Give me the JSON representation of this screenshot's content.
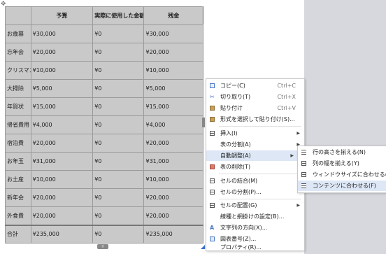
{
  "table": {
    "headers": [
      "",
      "予算",
      "実際に使用した金額",
      "残金"
    ],
    "rows": [
      [
        "お歳暮",
        "¥30,000",
        "¥0",
        "¥30,000"
      ],
      [
        "忘年会",
        "¥20,000",
        "¥0",
        "¥20,000"
      ],
      [
        "クリスマス",
        "¥10,000",
        "¥0",
        "¥10,000"
      ],
      [
        "大掃除",
        "¥5,000",
        "¥0",
        "¥5,000"
      ],
      [
        "年賀状",
        "¥15,000",
        "¥0",
        "¥15,000"
      ],
      [
        "帰省費用",
        "¥4,000",
        "¥0",
        "¥4,000"
      ],
      [
        "宿泊費",
        "¥20,000",
        "¥0",
        "¥20,000"
      ],
      [
        "お年玉",
        "¥31,000",
        "¥0",
        "¥31,000"
      ],
      [
        "お土産",
        "¥10,000",
        "¥0",
        "¥10,000"
      ],
      [
        "新年会",
        "¥20,000",
        "¥0",
        "¥20,000"
      ],
      [
        "外食費",
        "¥20,000",
        "¥0",
        "¥20,000"
      ]
    ],
    "total": [
      "合計",
      "¥235,000",
      "¥0",
      "¥235,000"
    ]
  },
  "menu": {
    "copy": {
      "label": "コピー(C)",
      "shortcut": "Ctrl+C"
    },
    "cut": {
      "label": "切り取り(T)",
      "shortcut": "Ctrl+X"
    },
    "paste": {
      "label": "貼り付け",
      "shortcut": "Ctrl+V"
    },
    "paste_special": {
      "label": "形式を選択して貼り付け(S)..."
    },
    "insert": {
      "label": "挿入(I)"
    },
    "split_table": {
      "label": "表の分割(A)"
    },
    "autofit": {
      "label": "自動調整(A)"
    },
    "delete_table": {
      "label": "表の削除(T)"
    },
    "merge_cells": {
      "label": "セルの結合(M)"
    },
    "split_cells": {
      "label": "セルの分割(P)..."
    },
    "cell_alignment": {
      "label": "セルの配置(G)"
    },
    "borders": {
      "label": "線種と網掛けの設定(B)..."
    },
    "text_direction": {
      "label": "文字列の方向(X)..."
    },
    "caption": {
      "label": "図表番号(Z)..."
    },
    "properties": {
      "label": "プロパティ(R)..."
    }
  },
  "submenu": {
    "equal_rows": "行の高さを揃える(N)",
    "equal_cols": "列の幅を揃える(Y)",
    "fit_window": "ウィンドウサイズに合わせる(W)",
    "fit_contents": "コンテンツに合わせる(F)"
  }
}
